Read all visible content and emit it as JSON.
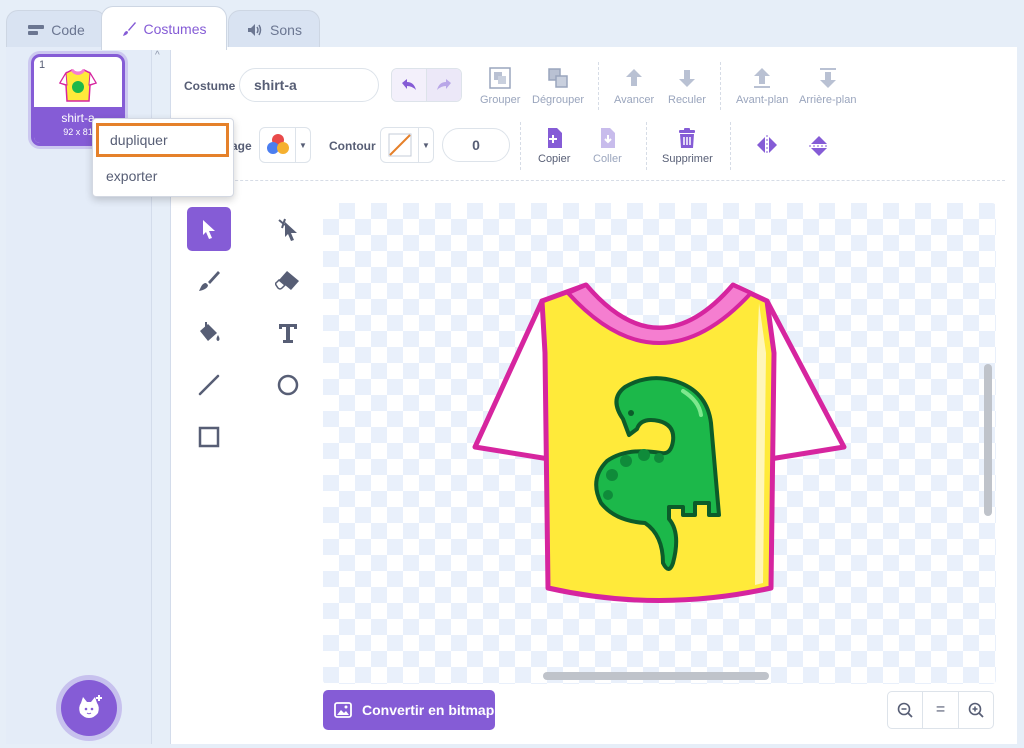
{
  "tabs": [
    {
      "label": "Code",
      "icon": "code-icon"
    },
    {
      "label": "Costumes",
      "icon": "brush-icon"
    },
    {
      "label": "Sons",
      "icon": "speaker-icon"
    }
  ],
  "costume_list": {
    "items": [
      {
        "number": "1",
        "name": "shirt-a",
        "size": "92 x 81"
      }
    ],
    "context_menu": [
      "dupliquer",
      "exporter"
    ]
  },
  "toolbar": {
    "costume_label": "Costume",
    "costume_name": "shirt-a",
    "group": "Grouper",
    "ungroup": "Dégrouper",
    "forward": "Avancer",
    "backward": "Reculer",
    "front": "Avant-plan",
    "back": "Arrière-plan",
    "fill_label": "age",
    "stroke_label": "Contour",
    "stroke_width": "0",
    "copy": "Copier",
    "paste": "Coller",
    "delete": "Supprimer"
  },
  "bottom": {
    "convert_bitmap": "Convertir en bitmap",
    "zoom_out": "−",
    "zoom_reset": "=",
    "zoom_in": "+"
  },
  "colors": {
    "accent": "#855cd6",
    "menu_highlight": "#e5812a",
    "shirt_yellow": "#ffea3a",
    "shirt_pink": "#f57ed0",
    "shirt_outline": "#d6259f",
    "dino_green": "#1cb84a"
  }
}
